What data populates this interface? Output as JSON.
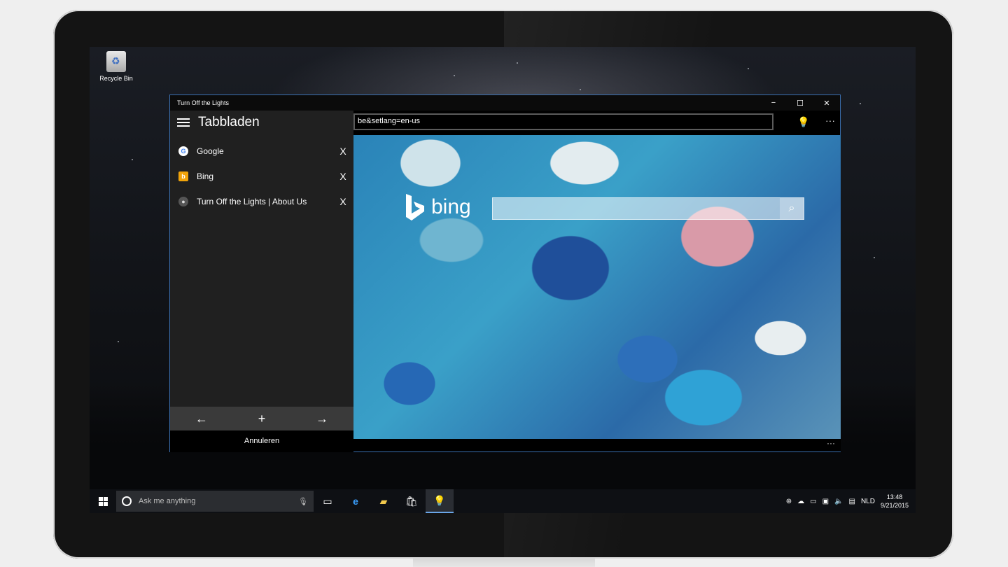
{
  "desktop": {
    "recycle_bin_label": "Recycle Bin"
  },
  "window": {
    "title": "Turn Off the Lights",
    "controls": {
      "minimize": "−",
      "maximize": "☐",
      "close": "✕"
    }
  },
  "toolbar": {
    "address_value": "be&setlang=en-us",
    "lights_icon": "lightbulb-icon",
    "more_label": "···"
  },
  "tabs_panel": {
    "title": "Tabbladen",
    "tabs": [
      {
        "label": "Google",
        "icon": "google-icon",
        "close": "X"
      },
      {
        "label": "Bing",
        "icon": "bing-icon",
        "close": "X"
      },
      {
        "label": "Turn Off the Lights | About Us",
        "icon": "lightbulb-icon",
        "close": "X"
      }
    ],
    "nav": {
      "back": "←",
      "add": "+",
      "forward": "→"
    },
    "cancel_label": "Annuleren"
  },
  "page": {
    "bing_wordmark": "bing",
    "search_icon": "search-icon",
    "bottom_more": "···"
  },
  "taskbar": {
    "search_placeholder": "Ask me anything",
    "language": "NLD",
    "time": "13:48",
    "date": "9/21/2015"
  },
  "colors": {
    "window_border": "#3a6fb0",
    "panel_bg": "#202020",
    "taskbar_bg": "#0e1014",
    "active_indicator": "#6aa6e8"
  }
}
